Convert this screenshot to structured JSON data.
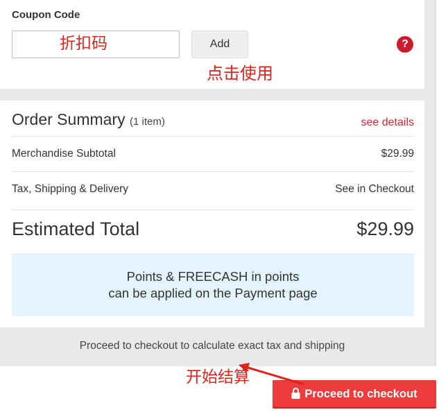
{
  "coupon": {
    "title": "Coupon Code",
    "input_value": "",
    "add_label": "Add",
    "help_glyph": "?",
    "help_icon": "question-icon"
  },
  "annotations": {
    "coupon_note": "折扣码",
    "use_note": "点击使用",
    "start_note": "开始结算",
    "color": "#e2231a"
  },
  "summary": {
    "title": "Order Summary",
    "count": "(1 item)",
    "see_details": "see details",
    "rows": [
      {
        "label": "Merchandise Subtotal",
        "value": "$29.99"
      },
      {
        "label": "Tax, Shipping & Delivery",
        "value": "See in Checkout"
      }
    ],
    "total_label": "Estimated Total",
    "total_value": "$29.99",
    "points_line1": "Points & FREECASH in points",
    "points_line2": "can be applied on the Payment page"
  },
  "footer": {
    "calc_note": "Proceed to checkout to calculate exact tax and shipping",
    "checkout_label": "Proceed to checkout",
    "checkout_icon": "lock-icon"
  },
  "colors": {
    "accent_red": "#ee3b3b",
    "link_red": "#d7262e",
    "info_bg": "#e4f4fc",
    "frame_grey": "#e9e9e9"
  }
}
